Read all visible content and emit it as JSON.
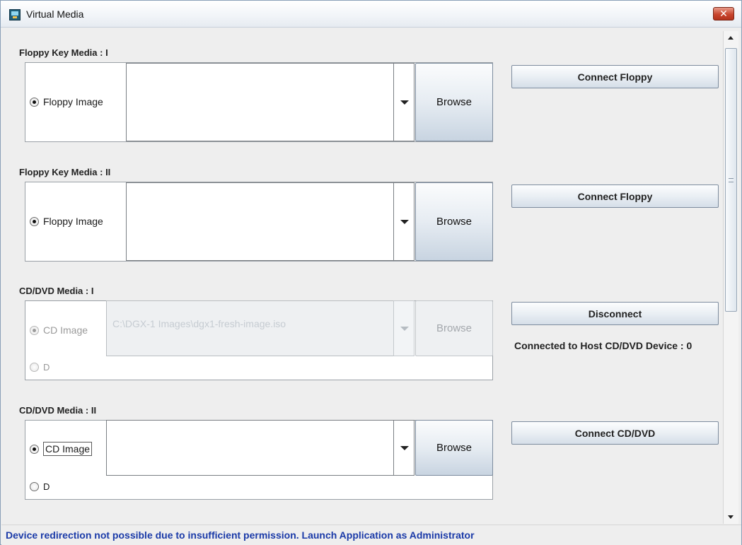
{
  "window": {
    "title": "Virtual Media",
    "close_label": "✕"
  },
  "sections": {
    "floppy1": {
      "label": "Floppy Key Media : I",
      "radio_label": "Floppy Image",
      "combo_value": "",
      "browse_label": "Browse",
      "action_label": "Connect Floppy"
    },
    "floppy2": {
      "label": "Floppy Key Media : II",
      "radio_label": "Floppy Image",
      "combo_value": "",
      "browse_label": "Browse",
      "action_label": "Connect Floppy"
    },
    "cd1": {
      "label": "CD/DVD Media : I",
      "radio_label": "CD Image",
      "radio2_label": "D",
      "combo_value": "C:\\DGX-1 Images\\dgx1-fresh-image.iso",
      "browse_label": "Browse",
      "action_label": "Disconnect",
      "status": "Connected to Host CD/DVD Device : 0"
    },
    "cd2": {
      "label": "CD/DVD Media : II",
      "radio_label": "CD Image",
      "radio2_label": "D",
      "combo_value": "",
      "browse_label": "Browse",
      "action_label": "Connect CD/DVD"
    }
  },
  "footer": {
    "message": "Device redirection not possible due to insufficient permission. Launch Application as Administrator"
  },
  "colors": {
    "footer_text": "#1a3aa8",
    "close_button": "#c8452e"
  }
}
